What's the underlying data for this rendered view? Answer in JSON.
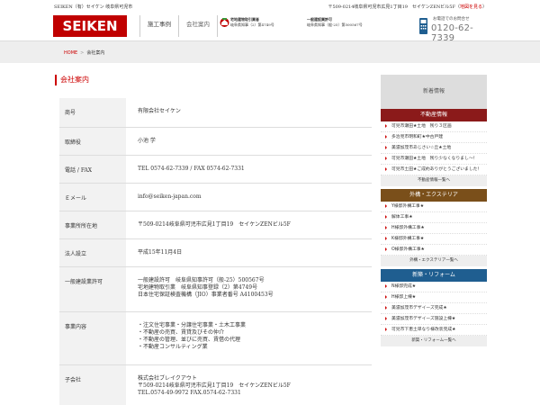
{
  "topbar": {
    "left_text": "SEIKEN（有）セイケン 岐阜県可児市",
    "address": "〒509-0214岐阜県可児市広見1丁目19　セイケンZENビル5F",
    "map_link": "地図を見る"
  },
  "header": {
    "logo_text": "SEIKEN",
    "nav": [
      "施工事例",
      "会社案内"
    ],
    "license1": {
      "title": "宅地建物取引業者",
      "number": "岐阜県知事（2）第4749号"
    },
    "license2": {
      "title": "一般建設業許可",
      "number": "岐阜県知事（般-25）第500567号"
    },
    "tel_note": "お電話でのお問合せ",
    "tel": "0120-62-7339"
  },
  "breadcrumb": {
    "home": "HOME",
    "sep": ">",
    "current": "会社案内"
  },
  "page_title": "会社案内",
  "rows": [
    {
      "label": "商号",
      "lines": [
        "有限会社セイケン"
      ],
      "h": 32
    },
    {
      "label": "取締役",
      "lines": [
        "小池 学"
      ],
      "h": 31
    },
    {
      "label": "電話 / FAX",
      "lines": [
        "TEL 0574-62-7339 / FAX 0574-62-7331"
      ],
      "h": 31
    },
    {
      "label": "Ｅメール",
      "lines": [
        "info@seiken-japan.com"
      ],
      "h": 31
    },
    {
      "label": "事業所所在地",
      "lines": [
        "〒509-0214岐阜県可児市広見1丁目19　セイケンZENビル5F"
      ],
      "h": 31
    },
    {
      "label": "法人設立",
      "lines": [
        "平成15年11月4日"
      ],
      "h": 31
    },
    {
      "label": "一般建設業許可",
      "lines": [
        "一般建設許可　岐阜県知事許可（般-25）500567号",
        "宅地建物取引業　岐阜県知事登録（2）第4749号",
        "日本住宅保証検査機構（JIO）事業者番号 A4100453号"
      ],
      "h": 50
    },
    {
      "label": "事業内容",
      "lines": [
        "・注文住宅事業・分譲住宅事業・土木工事業",
        "・不動産の売買、賃貸及びその仲介",
        "・不動産の管理、並びに売買、賃借の代理",
        "・不動産コンサルティング業"
      ],
      "h": 59
    },
    {
      "label": "子会社",
      "lines": [
        "株式会社ブレイクアウト",
        "〒509-0214岐阜県可児市広見1丁目19　セイケンZENビル5F",
        "TEL.0574-49-9972 FAX.0574-62-7331"
      ],
      "h": 55
    }
  ],
  "sidebar": {
    "head": "新着情報",
    "sections": [
      {
        "title": "不動産情報",
        "items": [
          "可児市瀬田★土地　残り３区画",
          "多治見市明和町★中古戸建",
          "美濃加茂市あじさい☆丘★土地",
          "可児市瀬田★土地　残り少なくなりまし～！",
          "可児市土田★ご成約ありがとうございました！"
        ],
        "more": "不動産情報一覧へ"
      },
      {
        "title": "外構・エクステリア",
        "items": [
          "Y様邸外構工事★",
          "解体工事★",
          "H様邸外構工事★",
          "K様邸外構工事★",
          "O様邸外構工事★"
        ],
        "more": "外構・エクステリア一覧へ"
      },
      {
        "title": "新築・リフォーム",
        "items": [
          "N様邸完成★",
          "H様邸上棟★",
          "美濃加茂市デザイーズ完成★",
          "美濃加茂市デザイーズ施設上棟★",
          "可児市下恵土単なり様改装完成★"
        ],
        "more": "新築・リフォーム一覧へ"
      }
    ]
  },
  "colors": {
    "accent": "#c00000",
    "sec_red": "#8b1a1a",
    "sec_brown": "#7a4f1a",
    "sec_blue": "#1f5e90"
  }
}
